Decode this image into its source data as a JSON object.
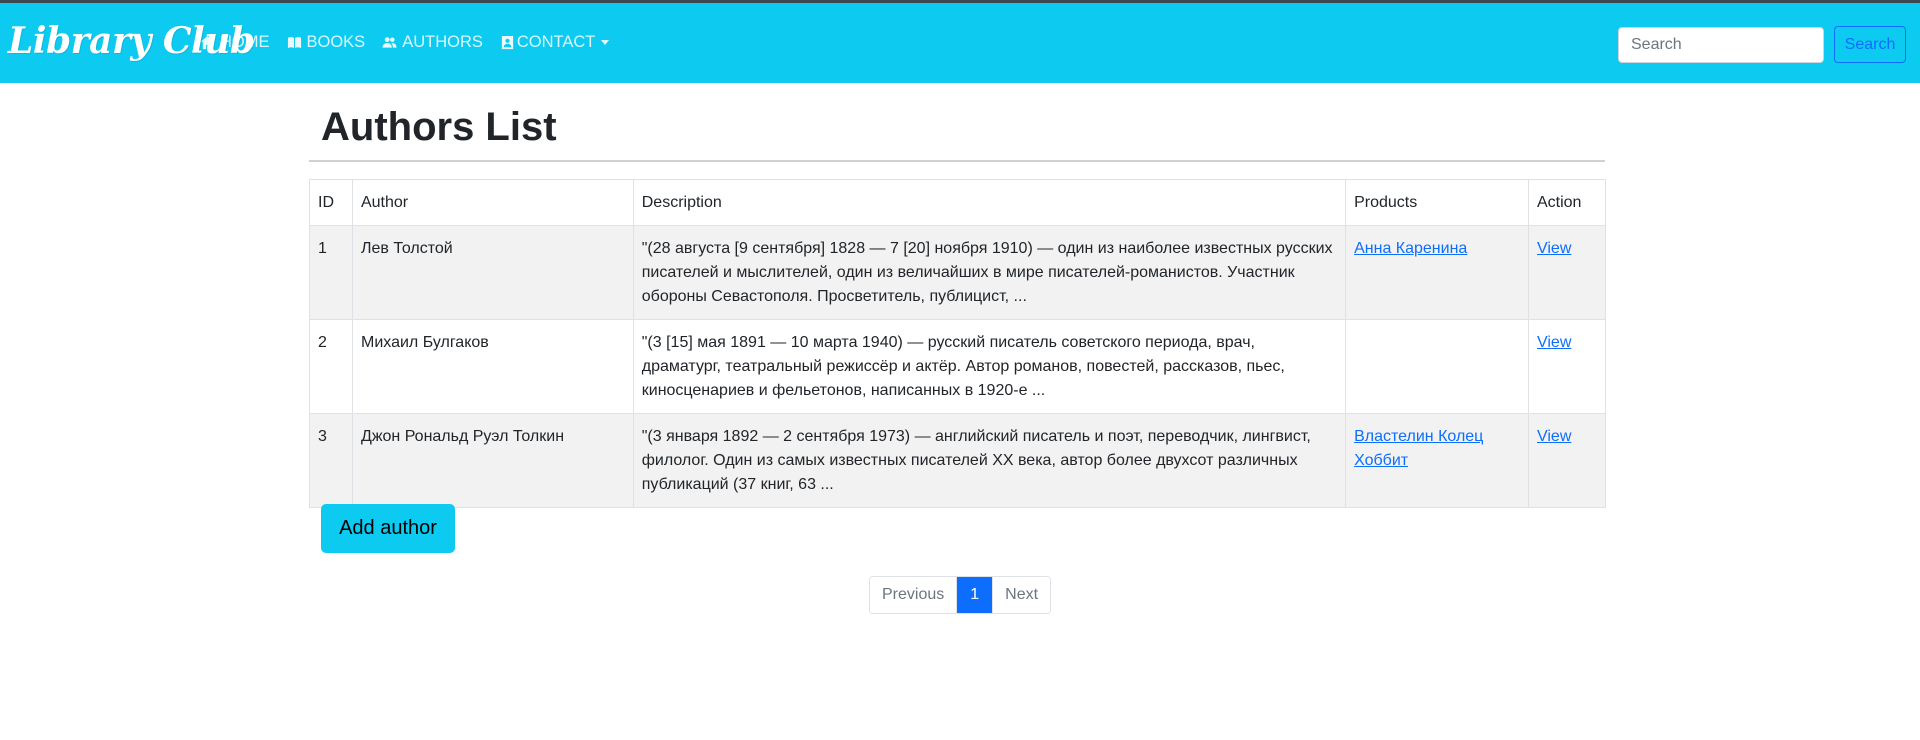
{
  "navbar": {
    "brand": "Library Club",
    "items": [
      {
        "label": "HOME",
        "icon": "home-icon"
      },
      {
        "label": "BOOKS",
        "icon": "book-icon"
      },
      {
        "label": "AUTHORS",
        "icon": "users-icon"
      },
      {
        "label": "CONTACT",
        "icon": "contact-card-icon",
        "dropdown": true
      }
    ],
    "search": {
      "placeholder": "Search",
      "button_label": "Search"
    },
    "colors": {
      "background": "#0dcaf0"
    }
  },
  "main": {
    "title": "Authors List",
    "table": {
      "headers": [
        "ID",
        "Author",
        "Description",
        "Products",
        "Action"
      ],
      "rows": [
        {
          "id": "1",
          "author": "Лев Толстой",
          "description": "\"(28 августа [9 сентября] 1828 — 7 [20] ноября 1910) — один из наиболее известных русских писателей и мыслителей, один из величайших в мире писателей-романистов. Участник обороны Севастополя. Просветитель, публицист, ...",
          "products": [
            "Анна Каренина"
          ],
          "action": "View"
        },
        {
          "id": "2",
          "author": "Михаил Булгаков",
          "description": "\"(3 [15] мая 1891 — 10 марта 1940) — русский писатель советского периода, врач, драматург, театральный режиссёр и актёр. Автор романов, повестей, рассказов, пьес, киносценариев и фельетонов, написанных в 1920-е ...",
          "products": [],
          "action": "View"
        },
        {
          "id": "3",
          "author": "Джон Рональд Руэл Толкин",
          "description": "\"(3 января 1892 — 2 сентября 1973) — английский писатель и поэт, переводчик, лингвист, филолог. Один из самых известных писателей XX века, автор более двухсот различных публикаций (37 книг, 63 ...",
          "products": [
            "Властелин Колец",
            "Хоббит"
          ],
          "action": "View"
        }
      ]
    },
    "add_button_label": "Add author",
    "pagination": {
      "previous": "Previous",
      "current": "1",
      "next": "Next"
    }
  }
}
